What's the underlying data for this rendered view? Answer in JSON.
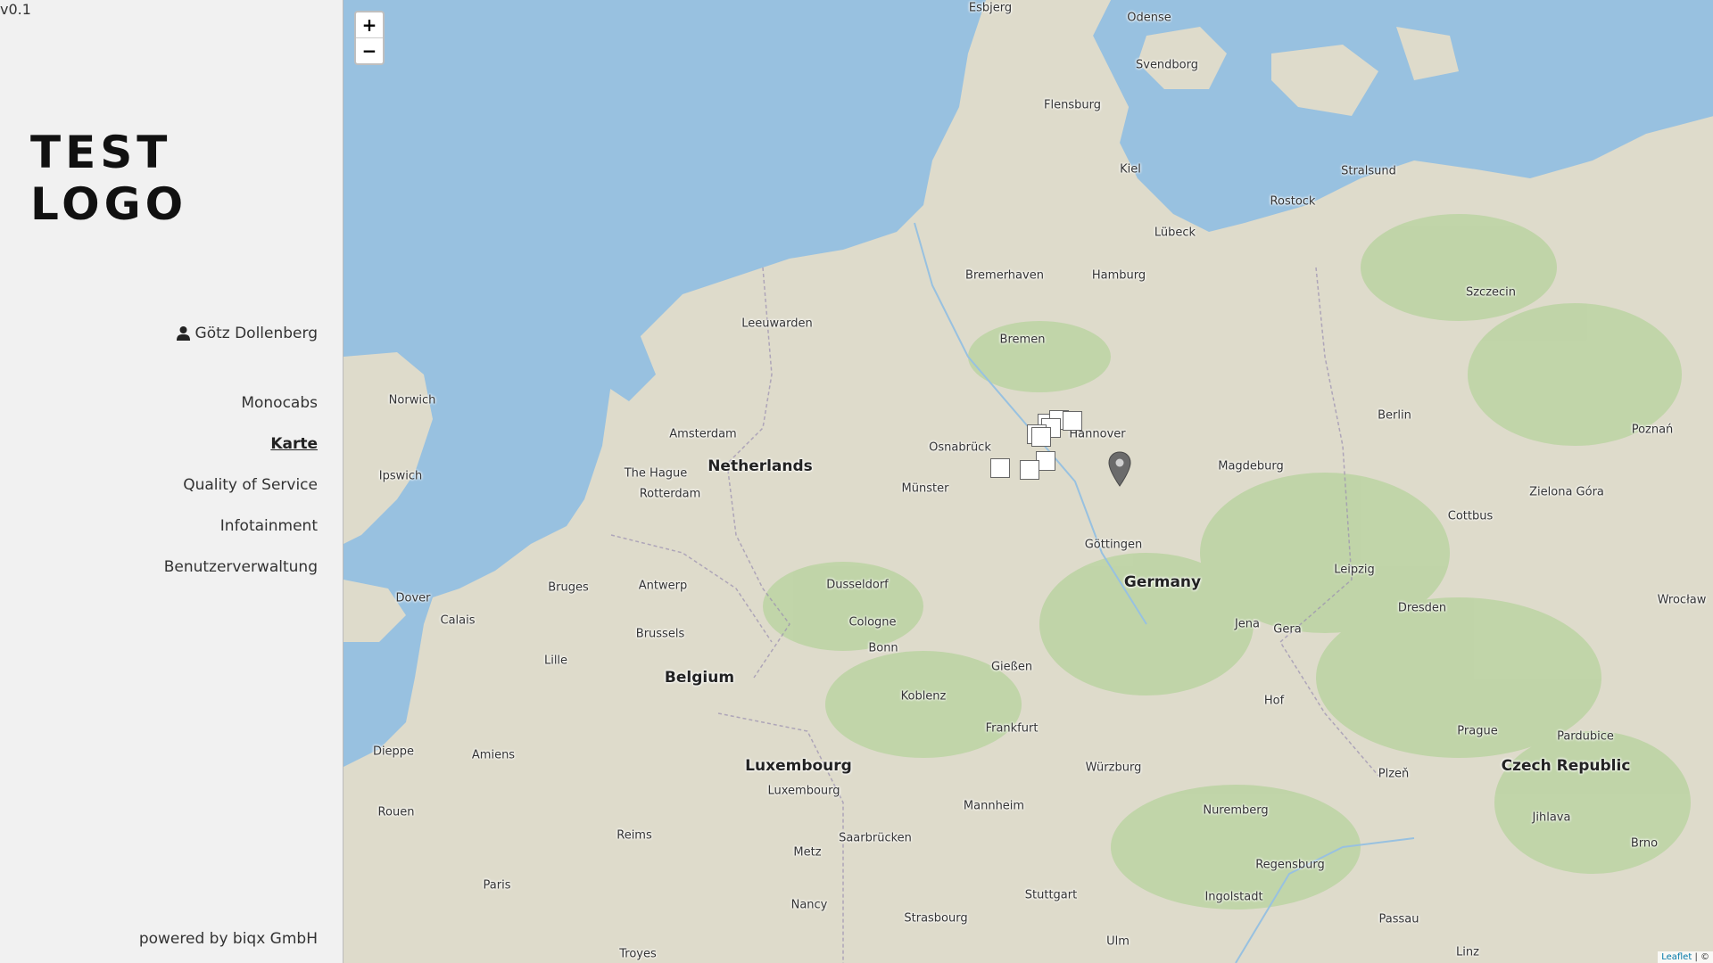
{
  "app": {
    "version": "v0.1",
    "logo_text": "TEST LOGO",
    "user_name": "Götz Dollenberg",
    "footer": "powered by biqx GmbH"
  },
  "nav": {
    "items": [
      {
        "label": "Monocabs",
        "active": false
      },
      {
        "label": "Karte",
        "active": true
      },
      {
        "label": "Quality of Service",
        "active": false
      },
      {
        "label": "Infotainment",
        "active": false
      },
      {
        "label": "Benutzerverwaltung",
        "active": false
      }
    ]
  },
  "map": {
    "zoom_in": "+",
    "zoom_out": "−",
    "attribution_leaflet": "Leaflet",
    "attribution_rest": "| ©",
    "colors": {
      "water": "#98c1e0",
      "land": "#dedbcb",
      "forest": "#b9d3a0"
    },
    "labels": {
      "esbjerg": "Esbjerg",
      "odense": "Odense",
      "svendborg": "Svendborg",
      "flensburg": "Flensburg",
      "kiel": "Kiel",
      "stralsund": "Stralsund",
      "rostock": "Rostock",
      "lubeck": "Lübeck",
      "bremerhaven": "Bremerhaven",
      "hamburg": "Hamburg",
      "szczecin": "Szczecin",
      "leeuwarden": "Leeuwarden",
      "bremen": "Bremen",
      "norwich": "Norwich",
      "berlin": "Berlin",
      "poznan": "Poznań",
      "amsterdam": "Amsterdam",
      "osnabruck": "Osnabrück",
      "hannover": "Hannover",
      "ipswich": "Ipswich",
      "the_hague": "The Hague",
      "netherlands": "Netherlands",
      "magdeburg": "Magdeburg",
      "rotterdam": "Rotterdam",
      "munster": "Münster",
      "zielona_gora": "Zielona Góra",
      "cottbus": "Cottbus",
      "gottingen": "Göttingen",
      "germany": "Germany",
      "leipzig": "Leipzig",
      "wroclaw": "Wrocław",
      "bruges": "Bruges",
      "antwerp": "Antwerp",
      "dusseldorf": "Dusseldorf",
      "dresden": "Dresden",
      "dover": "Dover",
      "calais": "Calais",
      "cologne": "Cologne",
      "jena": "Jena",
      "gera": "Gera",
      "brussels": "Brussels",
      "bonn": "Bonn",
      "lille": "Lille",
      "giessen": "Gießen",
      "belgium": "Belgium",
      "koblenz": "Koblenz",
      "hof": "Hof",
      "frankfurt": "Frankfurt",
      "prague": "Prague",
      "pardubice": "Pardubice",
      "dieppe": "Dieppe",
      "amiens": "Amiens",
      "luxembourg_country": "Luxembourg",
      "czech_republic": "Czech Republic",
      "wurzburg": "Würzburg",
      "plzen": "Plzeň",
      "luxembourg_city": "Luxembourg",
      "mannheim": "Mannheim",
      "rouen": "Rouen",
      "nuremberg": "Nuremberg",
      "jihlava": "Jihlava",
      "reims": "Reims",
      "saarbrucken": "Saarbrücken",
      "brno": "Brno",
      "metz": "Metz",
      "regensburg": "Regensburg",
      "paris": "Paris",
      "stuttgart": "Stuttgart",
      "ingolstadt": "Ingolstadt",
      "nancy": "Nancy",
      "strasbourg": "Strasbourg",
      "passau": "Passau",
      "ulm": "Ulm",
      "linz": "Linz",
      "troyes": "Troyes"
    }
  }
}
